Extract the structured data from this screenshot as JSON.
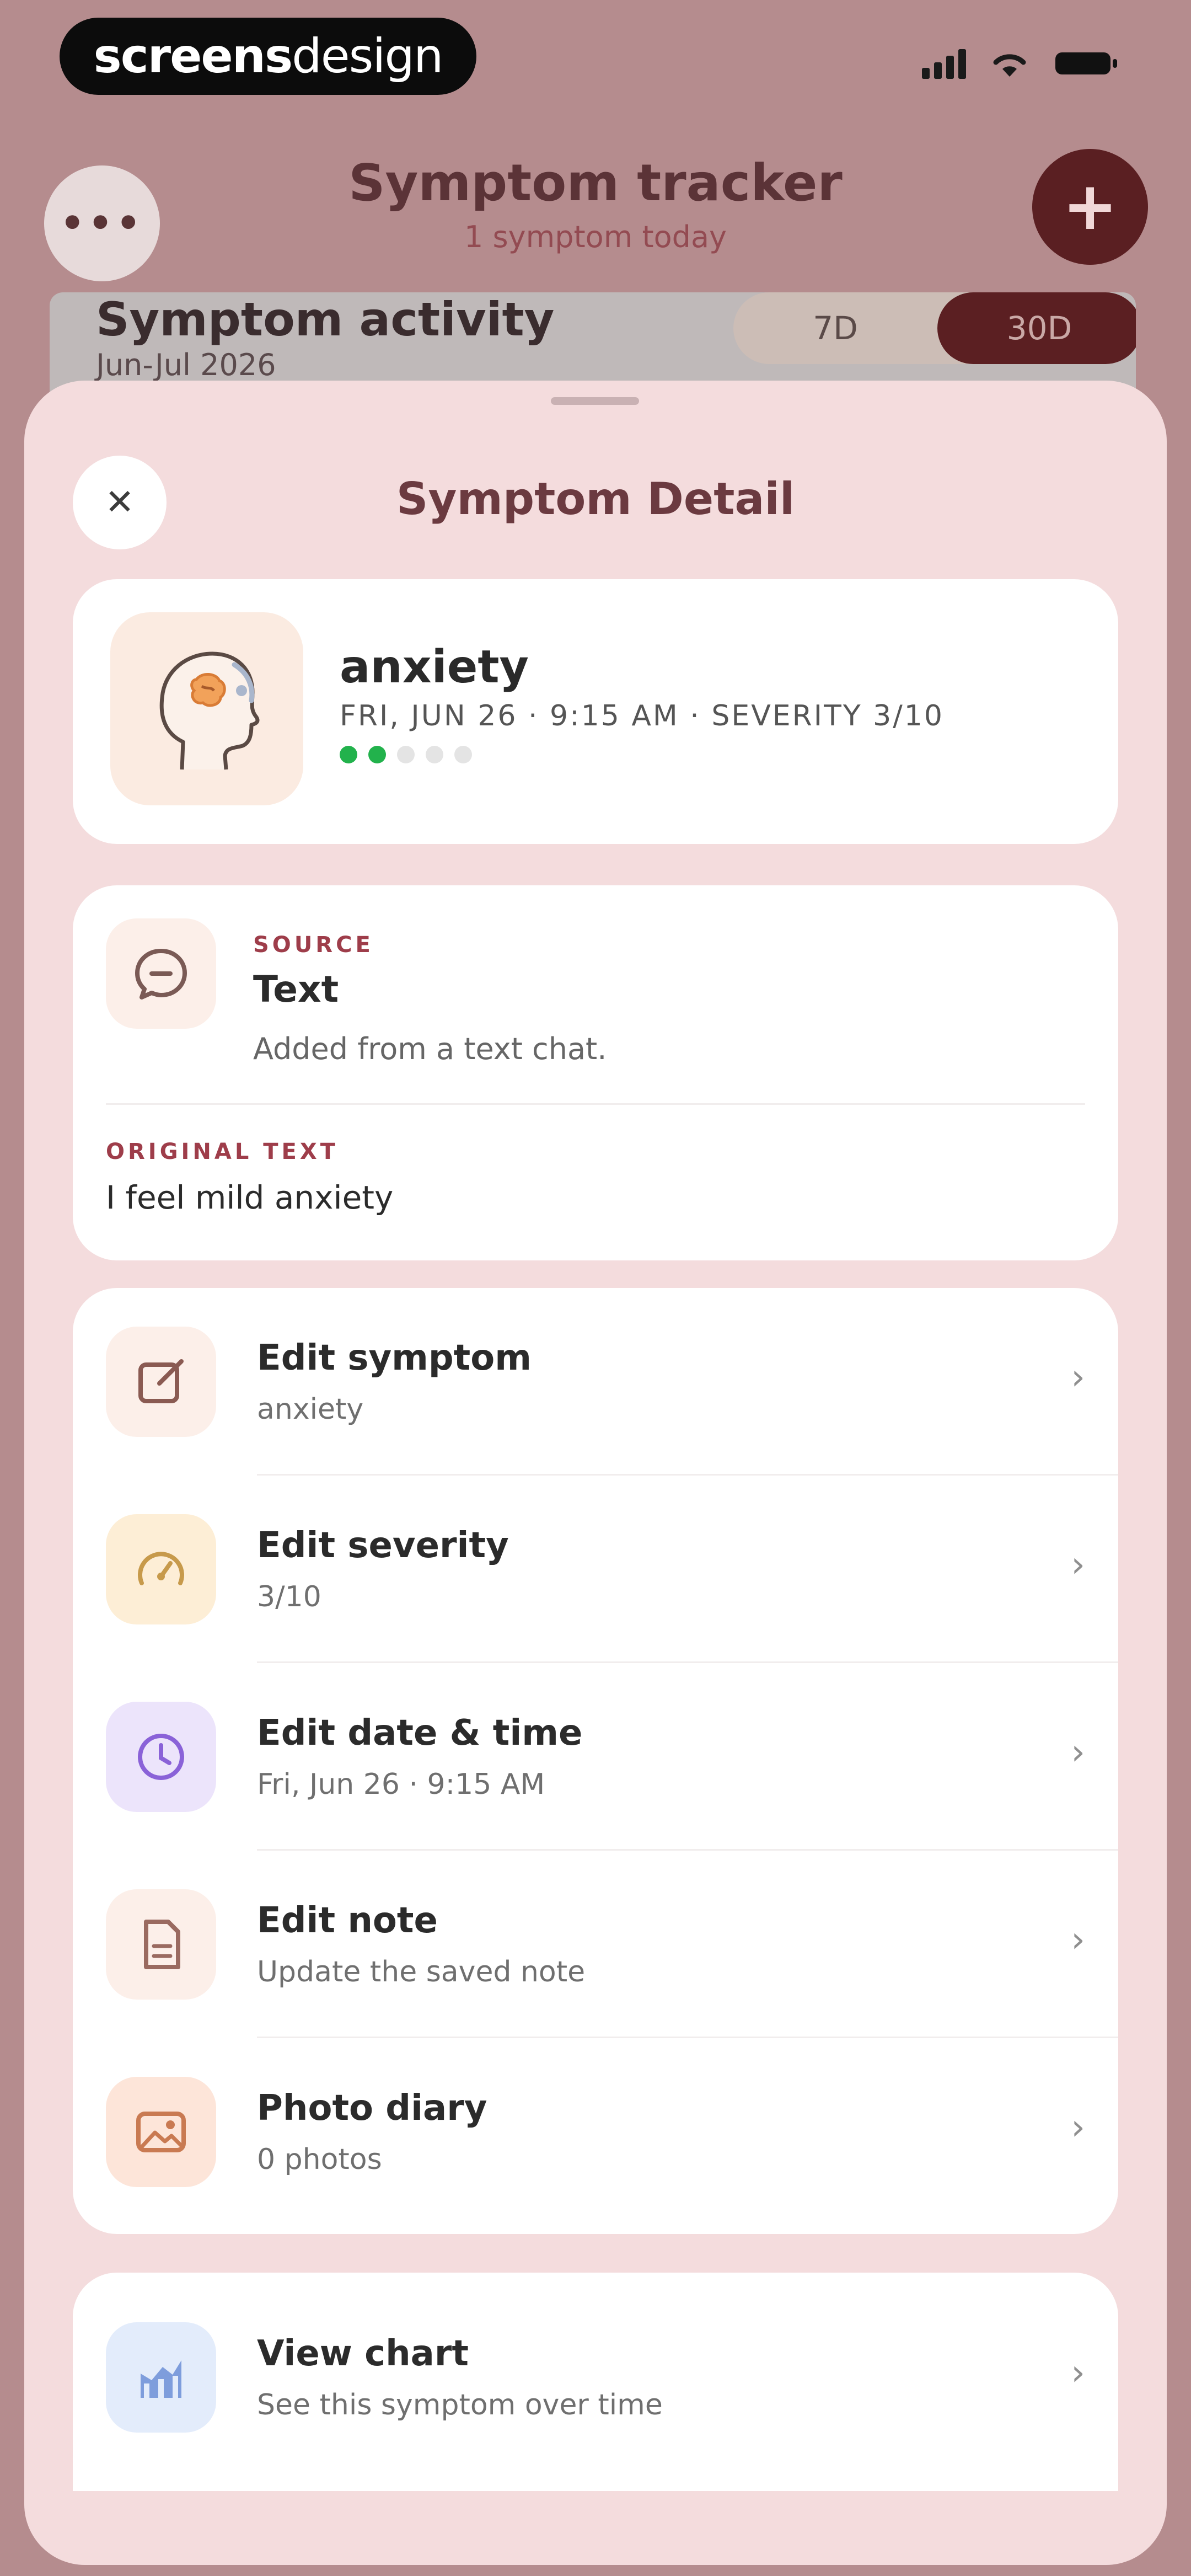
{
  "brand": {
    "part1": "screens",
    "part2": "design"
  },
  "header": {
    "title": "Symptom tracker",
    "subtitle": "1 symptom today",
    "more_label": "•••",
    "add_label": "+"
  },
  "activity": {
    "title": "Symptom activity",
    "date_range": "Jun-Jul 2026",
    "ranges": [
      "7D",
      "30D"
    ],
    "active_range": "30D"
  },
  "sheet": {
    "title": "Symptom Detail",
    "close_label": "✕"
  },
  "symptom": {
    "name": "anxiety",
    "meta": "FRI, JUN 26 · 9:15 AM · SEVERITY 3/10",
    "severity_dots_filled": 2,
    "severity_dots_total": 5
  },
  "source": {
    "label": "SOURCE",
    "value": "Text",
    "description": "Added from a text chat.",
    "original_label": "ORIGINAL TEXT",
    "original_value": "I feel mild anxiety"
  },
  "actions": [
    {
      "title": "Edit symptom",
      "subtitle": "anxiety",
      "icon": "edit-icon",
      "tile_color": "#fcefe9",
      "icon_color": "#8a5a52"
    },
    {
      "title": "Edit severity",
      "subtitle": "3/10",
      "icon": "gauge-icon",
      "tile_color": "#fdeed6",
      "icon_color": "#c79a4b"
    },
    {
      "title": "Edit date & time",
      "subtitle": "Fri, Jun 26 · 9:15 AM",
      "icon": "clock-icon",
      "tile_color": "#ece4fb",
      "icon_color": "#8a62d8"
    },
    {
      "title": "Edit note",
      "subtitle": "Update the saved note",
      "icon": "note-icon",
      "tile_color": "#fcefe9",
      "icon_color": "#9a6a60"
    },
    {
      "title": "Photo diary",
      "subtitle": "0 photos",
      "icon": "photo-icon",
      "tile_color": "#fde5d9",
      "icon_color": "#c97a52"
    }
  ],
  "chart_link": {
    "title": "View chart",
    "subtitle": "See this symptom over time",
    "icon": "chart-icon",
    "tile_color": "#e3ecfb",
    "icon_color": "#6c8fd6"
  },
  "colors": {
    "accent": "#5b1f22",
    "sheet_bg": "#f4dcdd",
    "label_red": "#9e3d4a",
    "severity_green": "#22b24c"
  }
}
